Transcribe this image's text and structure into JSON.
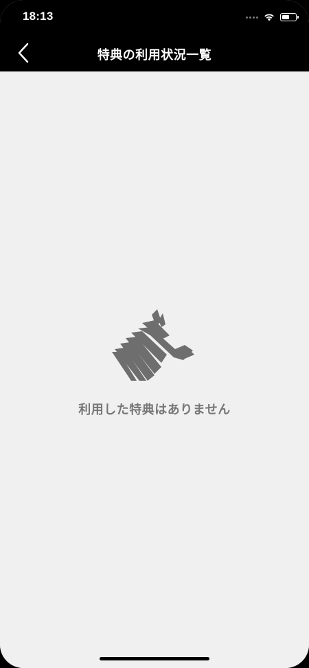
{
  "status_bar": {
    "time": "18:13",
    "icons": [
      "signal-dots-icon",
      "wifi-icon",
      "battery-icon"
    ]
  },
  "nav": {
    "title": "特典の利用状況一覧",
    "back_icon": "chevron-left-icon"
  },
  "empty_state": {
    "logo_icon": "zebra-logo-icon",
    "message": "利用した特典はありません"
  },
  "colors": {
    "header_bg": "#000000",
    "content_bg": "#f0f0f0",
    "message_text": "#777777",
    "logo": "#6e6e6e"
  }
}
